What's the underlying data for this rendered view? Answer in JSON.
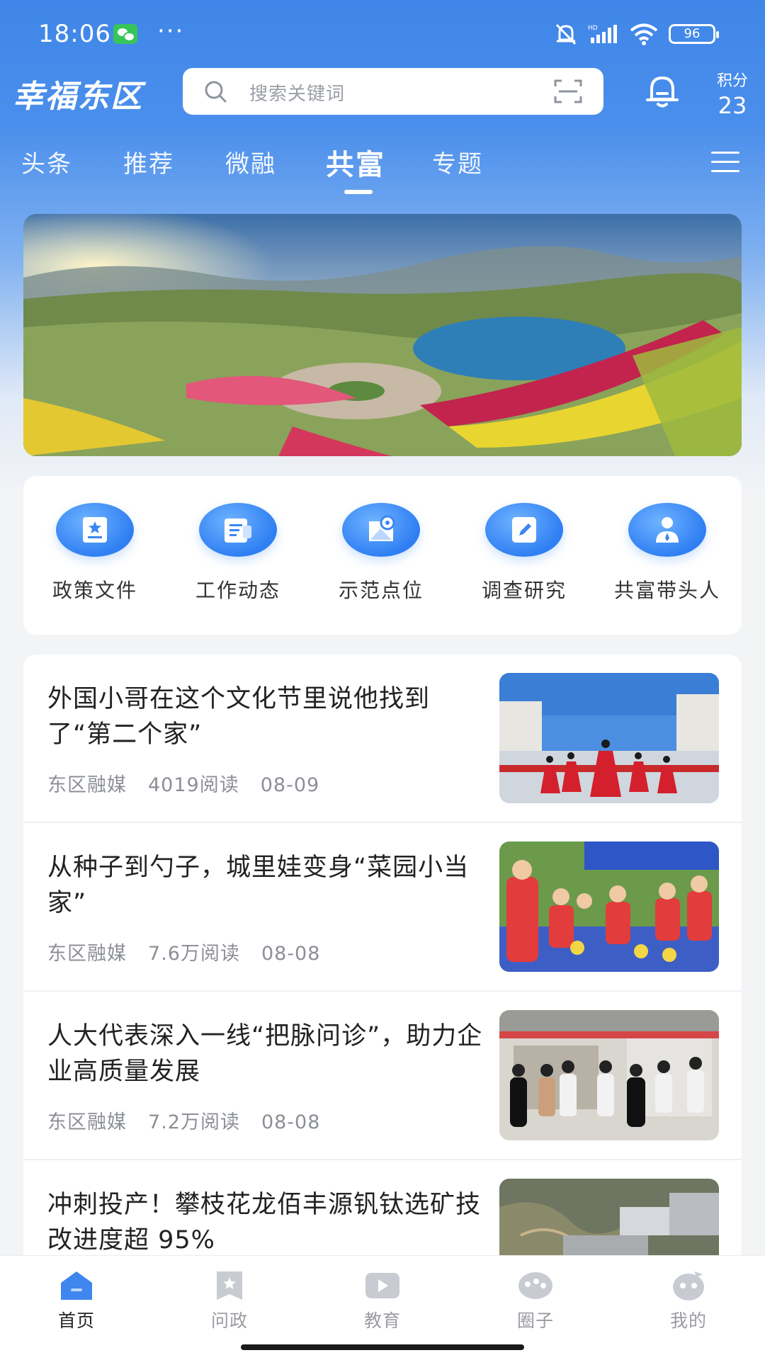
{
  "status_bar": {
    "time": "18:06",
    "dots": "···",
    "battery": "96"
  },
  "header": {
    "app_title": "幸福东区",
    "search_placeholder": "搜索关键词",
    "points_label": "积分",
    "points_value": "23"
  },
  "tabs": [
    {
      "label": "头条"
    },
    {
      "label": "推荐"
    },
    {
      "label": "微融"
    },
    {
      "label": "共富",
      "active": true
    },
    {
      "label": "专题"
    }
  ],
  "quick_links": [
    {
      "label": "政策文件",
      "icon": "document-star-icon"
    },
    {
      "label": "工作动态",
      "icon": "notes-icon"
    },
    {
      "label": "示范点位",
      "icon": "map-pin-icon"
    },
    {
      "label": "调查研究",
      "icon": "edit-icon"
    },
    {
      "label": "共富带头人",
      "icon": "person-icon"
    }
  ],
  "news": [
    {
      "title": "外国小哥在这个文化节里说他找到了“第二个家”",
      "source": "东区融媒",
      "reads": "4019阅读",
      "date": "08-09"
    },
    {
      "title": "从种子到勺子，城里娃变身“菜园小当家”",
      "source": "东区融媒",
      "reads": "7.6万阅读",
      "date": "08-08"
    },
    {
      "title": "人大代表深入一线“把脉问诊”，助力企业高质量发展",
      "source": "东区融媒",
      "reads": "7.2万阅读",
      "date": "08-08"
    },
    {
      "title": "冲刺投产！攀枝花龙佰丰源钒钛选矿技改进度超 95%",
      "source": "",
      "reads": "",
      "date": ""
    }
  ],
  "bottom_nav": [
    {
      "label": "首页",
      "icon": "home-icon",
      "active": true
    },
    {
      "label": "问政",
      "icon": "question-flag-icon"
    },
    {
      "label": "教育",
      "icon": "video-play-icon"
    },
    {
      "label": "圈子",
      "icon": "circle-chat-icon"
    },
    {
      "label": "我的",
      "icon": "profile-icon"
    }
  ]
}
